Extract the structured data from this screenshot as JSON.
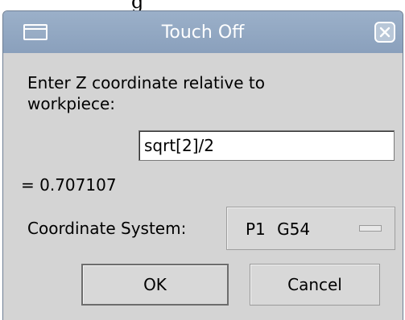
{
  "top_clip_text": "g",
  "dialog": {
    "title": "Touch Off",
    "prompt_line1": "Enter Z coordinate relative to",
    "prompt_line2": "workpiece:",
    "expression_value": "sqrt[2]/2",
    "result_text": "= 0.707107",
    "coord_system_label": "Coordinate System:",
    "coord_system_value": "P1  G54",
    "ok_label": "OK",
    "cancel_label": "Cancel"
  },
  "icons": {
    "window_menu": "window-menu-icon",
    "close": "close-icon",
    "option_indicator": "option-indicator-icon"
  },
  "colors": {
    "titlebar": "#8fa5c1",
    "dialog_bg": "#d4d4d4",
    "input_bg": "#ffffff"
  }
}
